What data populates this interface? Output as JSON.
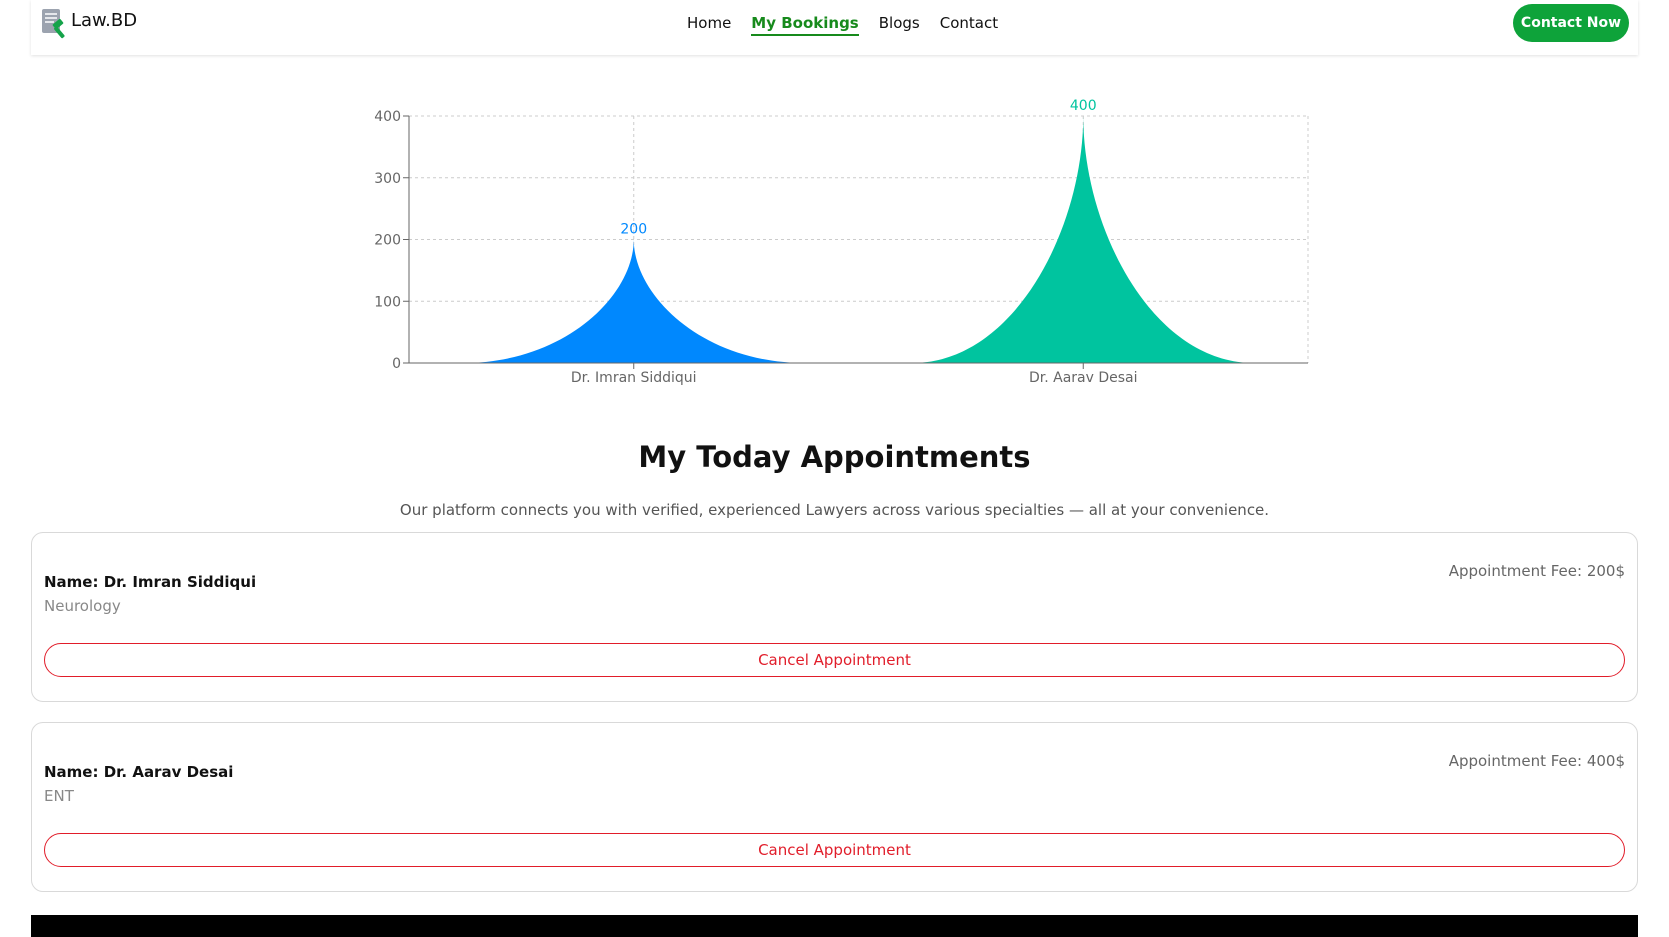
{
  "nav": {
    "brand": "Law.BD",
    "links": [
      "Home",
      "My Bookings",
      "Blogs",
      "Contact"
    ],
    "active_link": "My Bookings",
    "cta": "Contact Now"
  },
  "chart_data": {
    "type": "area",
    "categories": [
      "Dr. Imran Siddiqui",
      "Dr. Aarav Desai"
    ],
    "values": [
      200,
      400
    ],
    "data_labels": [
      "200",
      "400"
    ],
    "colors": [
      "#0088FE",
      "#00C49F"
    ],
    "ylim": [
      0,
      400
    ],
    "yticks": [
      0,
      100,
      200,
      300,
      400
    ],
    "grid": true,
    "legend": "none"
  },
  "section": {
    "title": "My Today Appointments",
    "subtitle": "Our platform connects you with verified, experienced Lawyers across various specialties — all at your convenience."
  },
  "appointments": [
    {
      "name": "Name: Dr. Imran Siddiqui",
      "specialty": "Neurology",
      "fee": "Appointment Fee: 200$",
      "action": "Cancel Appointment"
    },
    {
      "name": "Name: Dr. Aarav Desai",
      "specialty": "ENT",
      "fee": "Appointment Fee: 400$",
      "action": "Cancel Appointment"
    }
  ]
}
